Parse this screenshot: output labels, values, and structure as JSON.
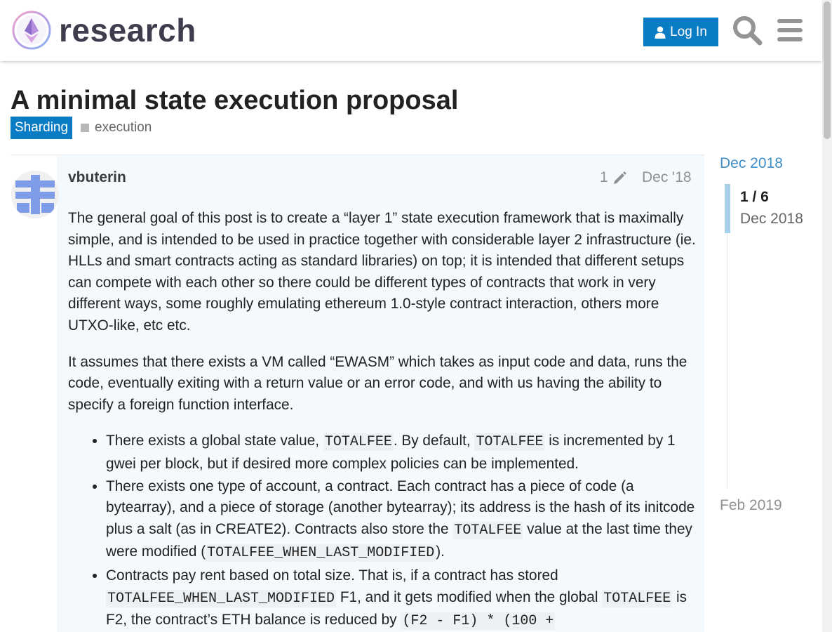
{
  "header": {
    "site_name": "research",
    "login_label": "Log In",
    "brand_color": "#0a7cc4"
  },
  "topic": {
    "title": "A minimal state execution proposal",
    "category": "Sharding",
    "tag": "execution"
  },
  "post": {
    "username": "vbuterin",
    "edit_count": "1",
    "date": "Dec '18",
    "paragraphs": [
      "The general goal of this post is to create a “layer 1” state execution framework that is maximally simple, and is intended to be used in practice together with considerable layer 2 infrastructure (ie. HLLs and smart contracts acting as standard libraries) on top; it is intended that different setups can compete with each other so there could be different types of contracts that work in very different ways, some roughly emulating ethereum 1.0-style contract interaction, others more UTXO-like, etc etc.",
      "It assumes that there exists a VM called “EWASM” which takes as input code and data, runs the code, eventually exiting with a return value or an error code, and with us having the ability to specify a foreign function interface."
    ],
    "bullet1": {
      "t1": "There exists a global state value, ",
      "c1": "TOTALFEE",
      "t2": ". By default, ",
      "c2": "TOTALFEE",
      "t3": " is incremented by 1 gwei per block, but if desired more complex policies can be implemented."
    },
    "bullet2": {
      "t1": "There exists one type of account, a contract. Each contract has a piece of code (a bytearray), and a piece of storage (another bytearray); its address is the hash of its initcode plus a salt (as in CREATE2). Contracts also store the ",
      "c1": "TOTALFEE",
      "t2": " value at the last time they were modified (",
      "c2": "TOTALFEE_WHEN_LAST_MODIFIED",
      "t3": ")."
    },
    "bullet3": {
      "t1": "Contracts pay rent based on total size. That is, if a contract has stored ",
      "c1": "TOTALFEE_WHEN_LAST_MODIFIED",
      "t2": " F1, and it gets modified when the global ",
      "c2": "TOTALFEE",
      "t3": " is F2, the contract’s ETH balance is reduced by ",
      "c3": "(F2 - F1) * (100 +"
    }
  },
  "timeline": {
    "start_label": "Dec 2018",
    "position": "1 / 6",
    "current_date": "Dec 2018",
    "end_label": "Feb 2019"
  }
}
